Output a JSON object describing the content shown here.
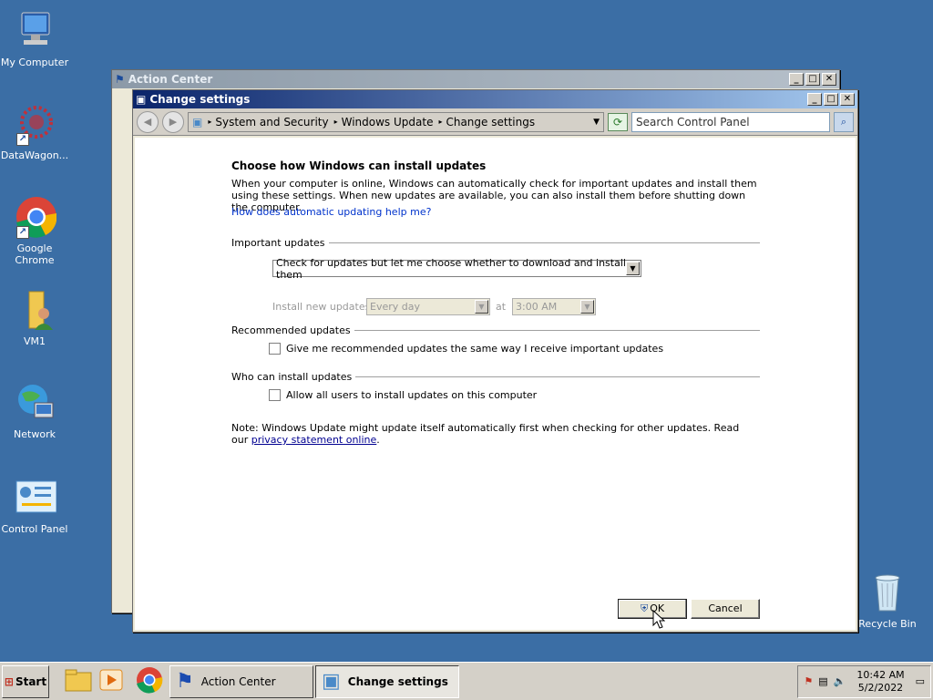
{
  "desktop": {
    "icons": [
      {
        "label": "My Computer"
      },
      {
        "label": "DataWagon..."
      },
      {
        "label": "Google Chrome"
      },
      {
        "label": "VM1"
      },
      {
        "label": "Network"
      },
      {
        "label": "Control Panel"
      },
      {
        "label": "Recycle Bin"
      }
    ]
  },
  "action_center": {
    "title": "Action Center"
  },
  "change_settings": {
    "title": "Change settings",
    "breadcrumb": [
      "System and Security",
      "Windows Update",
      "Change settings"
    ],
    "search_placeholder": "Search Control Panel",
    "heading": "Choose how Windows can install updates",
    "intro": "When your computer is online, Windows can automatically check for important updates and install them using these settings. When new updates are available, you can also install them before shutting down the computer.",
    "help_link": "How does automatic updating help me?",
    "important_group": "Important updates",
    "important_option": "Check for updates but let me choose whether to download and install them",
    "install_label": "Install new updates:",
    "install_day": "Every day",
    "at_label": "at",
    "install_time": "3:00 AM",
    "recommended_group": "Recommended updates",
    "recommended_check": "Give me recommended updates the same way I receive important updates",
    "who_group": "Who can install updates",
    "who_check": "Allow all users to install updates on this computer",
    "note_text": "Note: Windows Update might update itself automatically first when checking for other updates.  Read our ",
    "note_link": "privacy statement online",
    "note_end": ".",
    "ok_label": "OK",
    "cancel_label": "Cancel"
  },
  "taskbar": {
    "start_label": "Start",
    "tasks": [
      {
        "label": "Action Center"
      },
      {
        "label": "Change settings"
      }
    ],
    "clock_time": "10:42 AM",
    "clock_date": "5/2/2022"
  },
  "colors": {
    "desktop": "#3b6ea5",
    "title_active": "#0a246a"
  }
}
